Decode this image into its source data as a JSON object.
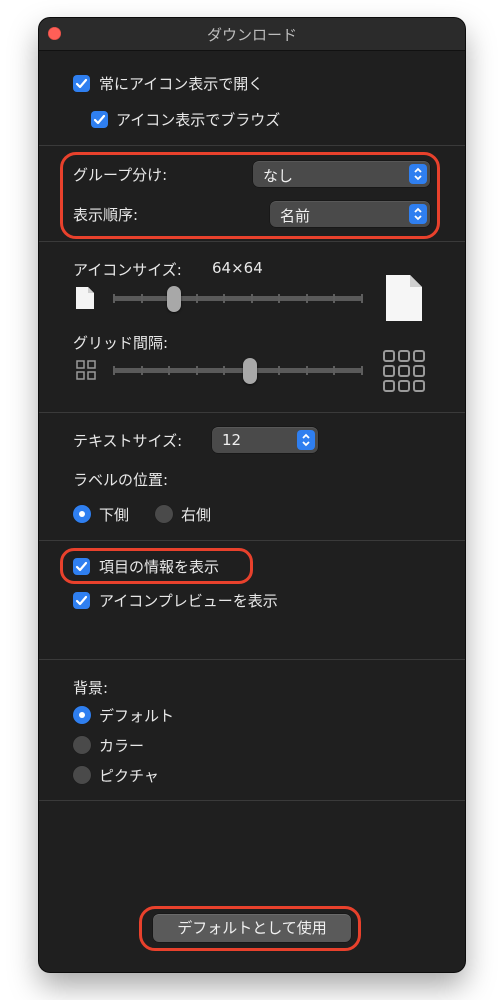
{
  "window": {
    "title": "ダウンロード"
  },
  "options": {
    "always_open_icon_view": "常にアイコン表示で開く",
    "browse_icon_view": "アイコン表示でブラウズ"
  },
  "grouping": {
    "label": "グループ分け:",
    "value": "なし"
  },
  "sort": {
    "label": "表示順序:",
    "value": "名前"
  },
  "icon_size": {
    "label": "アイコンサイズ:",
    "value": "64×64",
    "slider_fraction": 0.23
  },
  "grid_spacing": {
    "label": "グリッド間隔:",
    "slider_fraction": 0.55
  },
  "text_size": {
    "label": "テキストサイズ:",
    "value": "12"
  },
  "label_position": {
    "label": "ラベルの位置:",
    "options": [
      "下側",
      "右側"
    ],
    "selected": "下側"
  },
  "info": {
    "show_item_info": "項目の情報を表示",
    "show_icon_preview": "アイコンプレビューを表示"
  },
  "background": {
    "label": "背景:",
    "options": [
      "デフォルト",
      "カラー",
      "ピクチャ"
    ],
    "selected": "デフォルト"
  },
  "use_default_button": "デフォルトとして使用",
  "colors": {
    "accent": "#2f7ff0",
    "highlight": "#e8412c",
    "window_bg": "#1f1f1f"
  }
}
